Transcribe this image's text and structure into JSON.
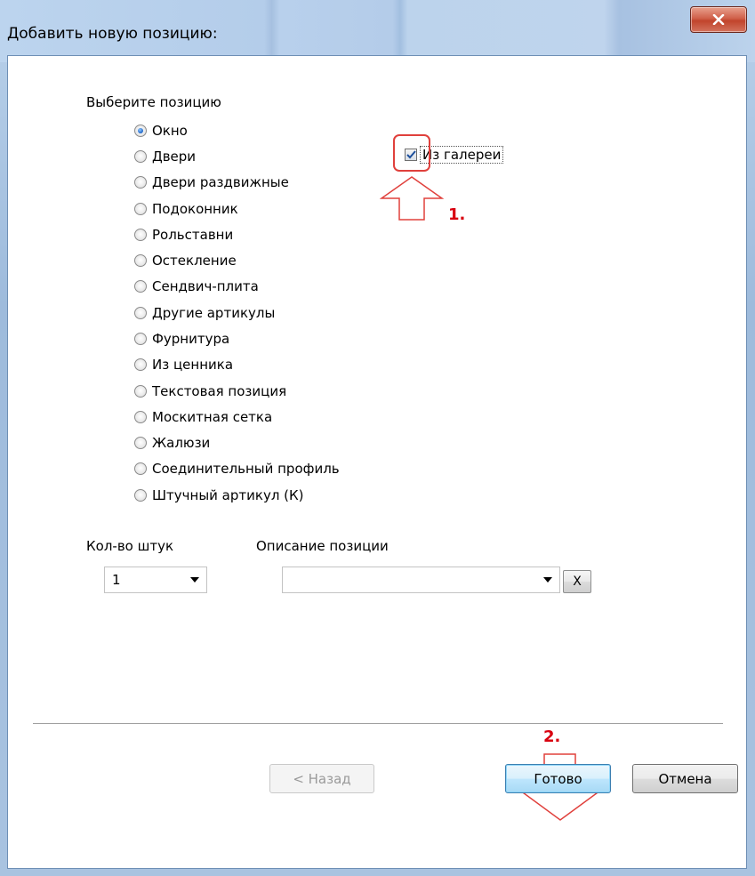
{
  "window": {
    "title": "Добавить новую позицию:"
  },
  "group_label": "Выберите позицию",
  "options": [
    {
      "label": "Окно",
      "checked": true
    },
    {
      "label": "Двери",
      "checked": false
    },
    {
      "label": "Двери раздвижные",
      "checked": false
    },
    {
      "label": "Подоконник",
      "checked": false
    },
    {
      "label": "Рольставни",
      "checked": false
    },
    {
      "label": "Остекление",
      "checked": false
    },
    {
      "label": "Сендвич-плита",
      "checked": false
    },
    {
      "label": "Другие артикулы",
      "checked": false
    },
    {
      "label": "Фурнитура",
      "checked": false
    },
    {
      "label": "Из ценника",
      "checked": false
    },
    {
      "label": "Текстовая позиция",
      "checked": false
    },
    {
      "label": "Москитная сетка",
      "checked": false
    },
    {
      "label": "Жалюзи",
      "checked": false
    },
    {
      "label": "Соединительный профиль",
      "checked": false
    },
    {
      "label": "Штучный артикул (К)",
      "checked": false
    }
  ],
  "gallery_checkbox": {
    "label": "Из галереи",
    "checked": true
  },
  "annotations": {
    "step1": "1.",
    "step2": "2.",
    "color": "#d8000f"
  },
  "quantity": {
    "label": "Кол-во штук",
    "value": "1"
  },
  "description": {
    "label": "Описание позиции",
    "value": "",
    "clear_label": "X"
  },
  "buttons": {
    "back": "< Назад",
    "done": "Готово",
    "cancel": "Отмена"
  }
}
